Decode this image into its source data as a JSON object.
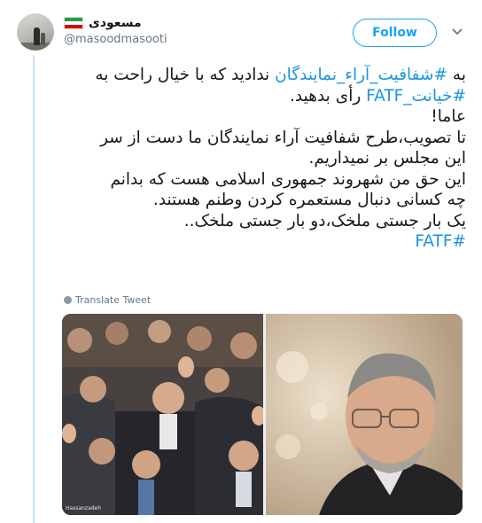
{
  "user": {
    "display_name": "مسعودی",
    "handle": "@masoodmasooti",
    "flag_colors": [
      "#239f40",
      "#ffffff",
      "#da0000"
    ]
  },
  "header": {
    "follow_label": "Follow",
    "chevron_icon": "chevron-down-icon"
  },
  "tweet": {
    "line1": {
      "pre": "به ",
      "tag": "#شفافیت_آراء_نمایندگان",
      "post": " ندادید که با خیال راحت به"
    },
    "line2": {
      "tag": "#خیانت_FATF",
      "post": " رأی بدهید."
    },
    "line3": "عاما!",
    "line4": "تا تصویب،طرح شفافیت آراء نمایندگان ما دست از سر",
    "line5": "این مجلس بر نمیداریم.",
    "line6": "این حق من شهروند جمهوری اسلامی هست که بدانم",
    "line7": "چه کسانی دنبال مستعمره کردن وطنم هستند.",
    "line8": "یک بار جستی ملخک،دو بار جستی ملخک..",
    "line9_tag": "#FATF"
  },
  "translate_label": "Translate Tweet",
  "media": {
    "left_photo_icon": "group-photo-image",
    "right_photo_icon": "portrait-photo-image",
    "photo_credit": "Hassanzadeh"
  },
  "colors": {
    "link": "#1b95e0",
    "follow": "#1da1f2",
    "muted": "#657786",
    "thread_line": "#cbe4f8"
  }
}
